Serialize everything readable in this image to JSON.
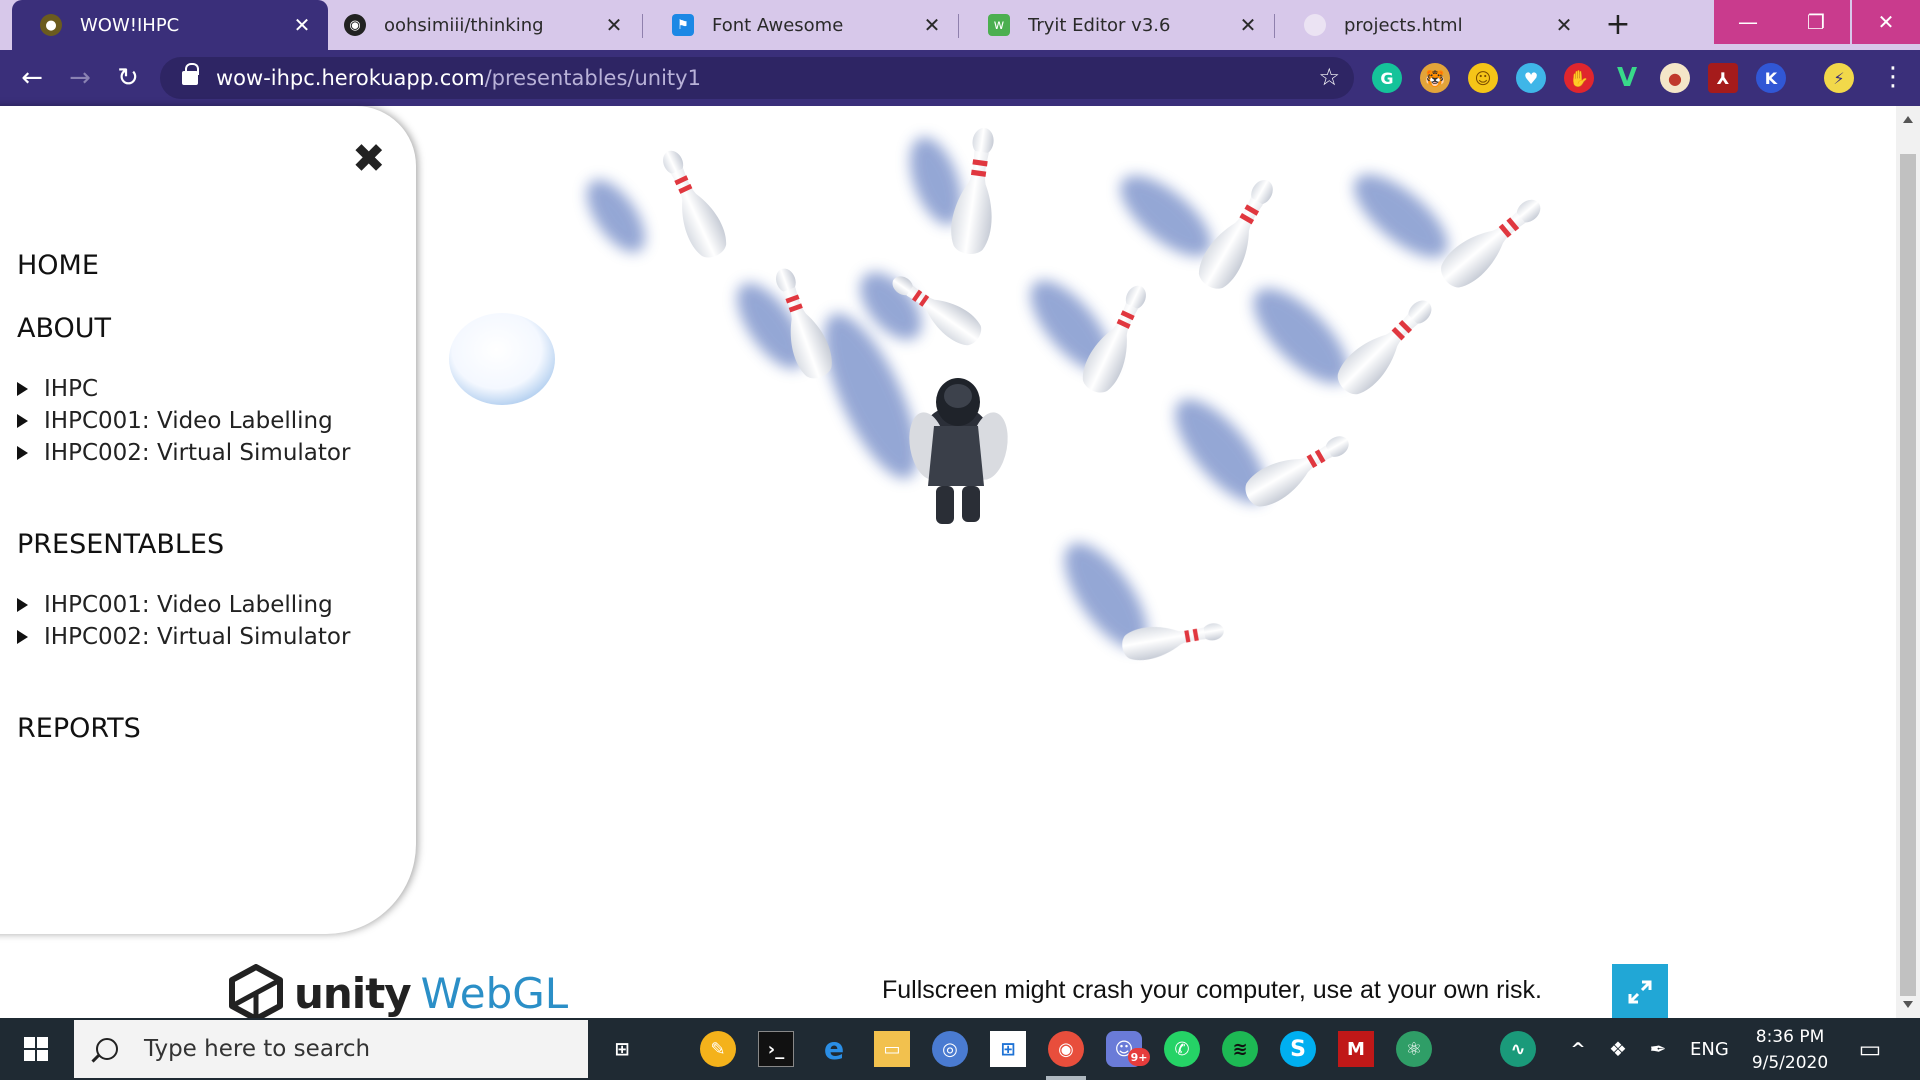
{
  "browser": {
    "tabs": [
      {
        "title": "WOW!IHPC",
        "favicon": "wow-ihpc-icon",
        "active": true
      },
      {
        "title": "oohsimiii/thinking",
        "favicon": "github-icon",
        "active": false
      },
      {
        "title": "Font Awesome",
        "favicon": "font-awesome-flag-icon",
        "active": false
      },
      {
        "title": "Tryit Editor v3.6",
        "favicon": "w3schools-icon",
        "active": false
      },
      {
        "title": "projects.html",
        "favicon": "loading-icon",
        "active": false
      }
    ],
    "address": {
      "host": "wow-ihpc.herokuapp.com",
      "path": "/presentables/unity1"
    },
    "theme_colors": {
      "frame": "#d7c8ea",
      "toolbar": "#3a2f7a",
      "window_controls": "#c93b8d"
    }
  },
  "sidebar": {
    "close_glyph": "✖",
    "home": "HOME",
    "about": "ABOUT",
    "about_items": [
      "IHPC",
      "IHPC001: Video Labelling",
      "IHPC002: Virtual Simulator"
    ],
    "presentables": "PRESENTABLES",
    "presentables_items": [
      "IHPC001: Video Labelling",
      "IHPC002: Virtual Simulator"
    ],
    "reports": "REPORTS"
  },
  "game": {
    "scene": "top-down bowling pins with player character and ball",
    "pin_stripe_color": "#e0373f",
    "shadow_color": "#3e5fb2"
  },
  "footer": {
    "logo_word": "unity",
    "logo_suffix": "WebGL",
    "warning": "Fullscreen might crash your computer, use at your own risk.",
    "fullscreen_color": "#21a7d6"
  },
  "taskbar": {
    "search_placeholder": "Type here to search",
    "language": "ENG",
    "time": "8:36 PM",
    "date": "9/5/2020",
    "notification_badge": "9+"
  }
}
